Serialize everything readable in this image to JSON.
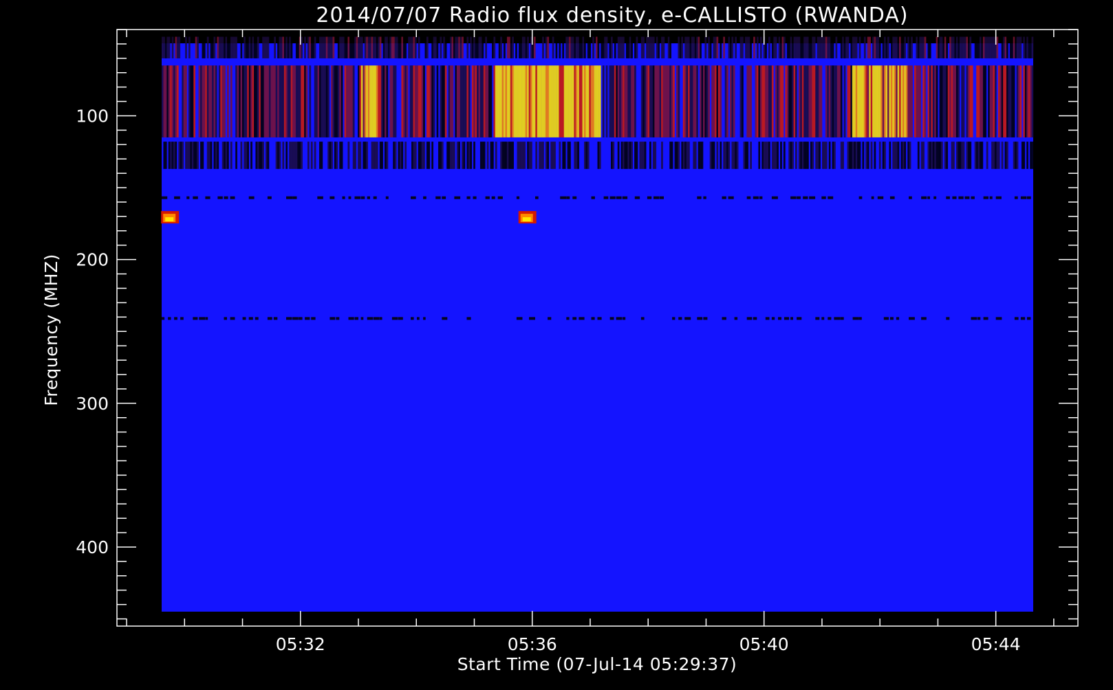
{
  "chart_data": {
    "type": "heatmap",
    "title": "2014/07/07  Radio flux density, e-CALLISTO (RWANDA)",
    "xlabel": "Start Time (07-Jul-14 05:29:37)",
    "ylabel": "Frequency (MHZ)",
    "x_unit": "UT time (HH:MM)",
    "x_range": [
      "05:29:37",
      "05:44:37"
    ],
    "x_axis_range": [
      "05:28:50",
      "05:45:25"
    ],
    "x_ticks": [
      "05:32",
      "05:36",
      "05:40",
      "05:44"
    ],
    "y_range_mhz": [
      45,
      445
    ],
    "y_axis_range_mhz": [
      40,
      455
    ],
    "y_inverted": true,
    "y_ticks": [
      100,
      200,
      300,
      400
    ],
    "y_minor_step_mhz": 10,
    "x_minor_step_min": 1,
    "colormap": [
      "#000000",
      "#1a0a3a",
      "#1414ff",
      "#7a1230",
      "#d41a00",
      "#ff8a00",
      "#ffe800"
    ],
    "background_color": "#1414ff",
    "features": [
      {
        "kind": "interference_band",
        "freq_range_mhz": [
          45,
          60
        ],
        "intensity": 0.45
      },
      {
        "kind": "interference_band",
        "freq_range_mhz": [
          65,
          115
        ],
        "intensity": 0.7
      },
      {
        "kind": "interference_band",
        "freq_range_mhz": [
          118,
          137
        ],
        "intensity": 0.35
      },
      {
        "kind": "enhanced_block",
        "time_range": [
          "05:35:20",
          "05:37:10"
        ],
        "freq_range_mhz": [
          65,
          115
        ],
        "intensity": 0.95
      },
      {
        "kind": "enhanced_block",
        "time_range": [
          "05:33:00",
          "05:33:20"
        ],
        "freq_range_mhz": [
          65,
          115
        ],
        "intensity": 0.85
      },
      {
        "kind": "enhanced_block",
        "time_range": [
          "05:41:30",
          "05:42:30"
        ],
        "freq_range_mhz": [
          65,
          115
        ],
        "intensity": 0.75
      },
      {
        "kind": "dark_line",
        "freq_mhz": 157
      },
      {
        "kind": "dark_line",
        "freq_mhz": 241
      },
      {
        "kind": "hot_spot",
        "time": "05:29:40",
        "freq_mhz": 172
      },
      {
        "kind": "hot_spot",
        "time": "05:35:50",
        "freq_mhz": 172
      }
    ]
  }
}
